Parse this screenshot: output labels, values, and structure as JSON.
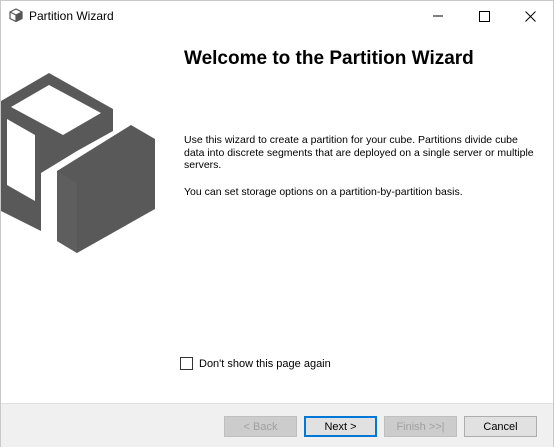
{
  "window": {
    "title": "Partition Wizard",
    "icon": "cube-icon"
  },
  "controls": {
    "minimize_icon": "minimize-icon",
    "maximize_icon": "maximize-icon",
    "close_icon": "close-icon"
  },
  "illustration": {
    "icon": "cube-partition-icon",
    "color": "#595959"
  },
  "page": {
    "heading": "Welcome to the Partition Wizard",
    "description": "Use this wizard to create a partition for your cube. Partitions divide cube data into discrete segments that are deployed on a single server or multiple servers.",
    "storage_note": "You can set storage options on a partition-by-partition basis."
  },
  "checkbox": {
    "label": "Don't show this page again",
    "checked": false
  },
  "buttons": {
    "back": "< Back",
    "next": "Next >",
    "finish": "Finish >>|",
    "cancel": "Cancel"
  },
  "colors": {
    "accent": "#0078d7",
    "footer_bg": "#f0f0f0"
  }
}
